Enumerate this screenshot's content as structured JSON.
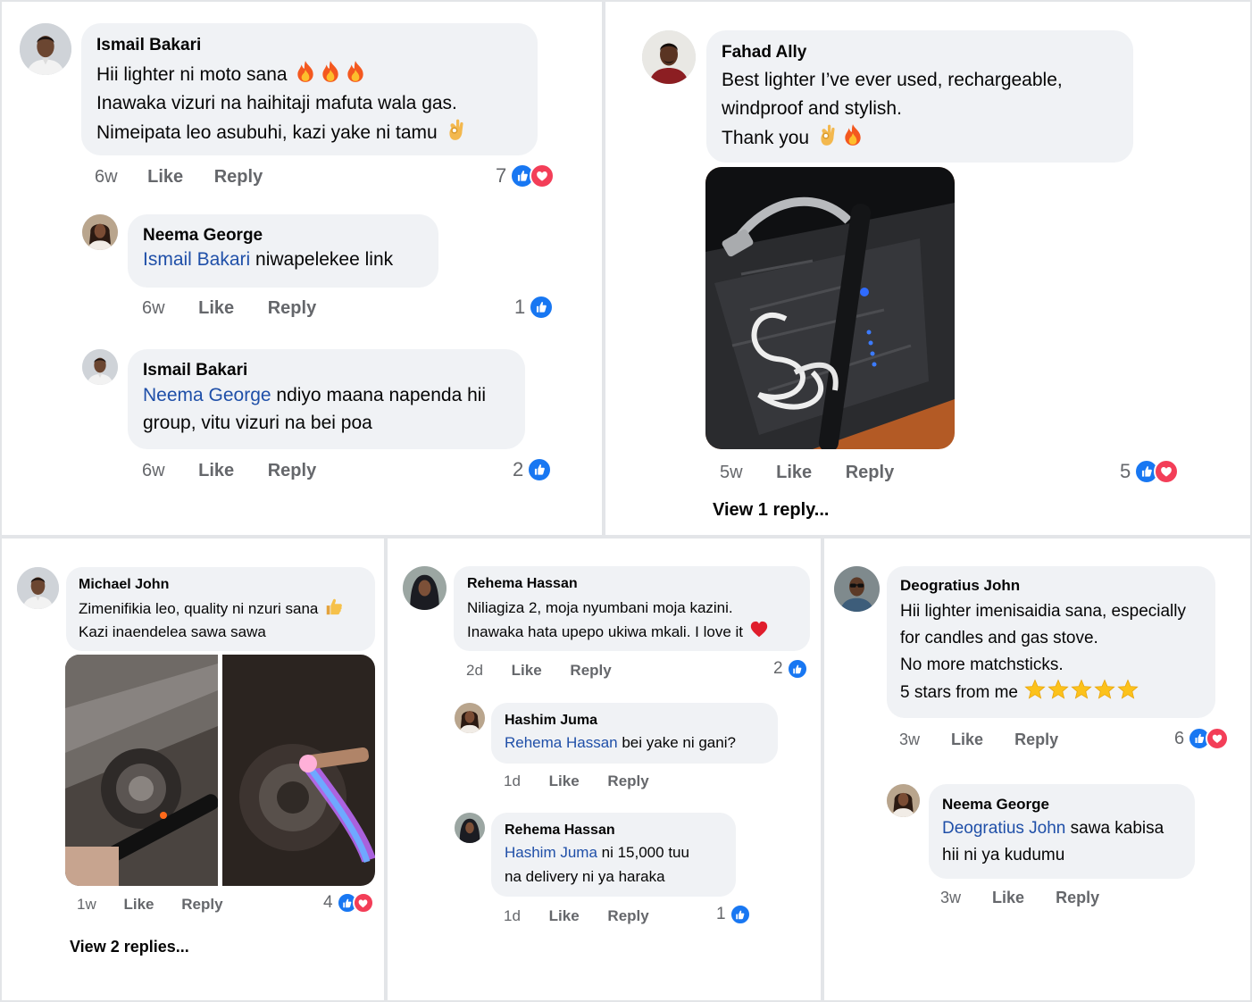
{
  "panel1": {
    "c1": {
      "author": "Ismail Bakari",
      "lines": [
        "Hii lighter ni moto sana",
        "Inawaka vizuri na haihitaji mafuta wala gas.",
        "Nimeipata leo asubuhi, kazi yake ni tamu"
      ],
      "time": "6w",
      "like": "Like",
      "reply": "Reply",
      "count": "7"
    },
    "c2": {
      "author": "Neema George",
      "mention": "Ismail Bakari",
      "text": " niwapelekee link",
      "time": "6w",
      "like": "Like",
      "reply": "Reply",
      "count": "1"
    },
    "c3": {
      "author": "Ismail Bakari",
      "mention": "Neema George",
      "text": " ndiyo maana napenda hii",
      "line2": "group, vitu vizuri na bei poa",
      "time": "6w",
      "like": "Like",
      "reply": "Reply",
      "count": "2"
    }
  },
  "panel2": {
    "c1": {
      "author": "Fahad Ally",
      "lines": [
        "Best lighter I’ve ever used, rechargeable,",
        "windproof and stylish.",
        "Thank you"
      ],
      "time": "5w",
      "like": "Like",
      "reply": "Reply",
      "count": "5"
    },
    "view_replies": "View 1 reply..."
  },
  "panel3": {
    "c1": {
      "author": "Michael John",
      "lines": [
        "Zimenifikia leo, quality ni nzuri sana",
        "Kazi inaendelea sawa sawa"
      ],
      "time": "1w",
      "like": "Like",
      "reply": "Reply",
      "count": "4"
    },
    "view_replies": "View 2 replies..."
  },
  "panel4": {
    "c1": {
      "author": "Rehema Hassan",
      "lines": [
        "Niliagiza 2, moja nyumbani moja kazini.",
        "Inawaka hata upepo ukiwa mkali. I love it"
      ],
      "time": "2d",
      "like": "Like",
      "reply": "Reply",
      "count": "2"
    },
    "c2": {
      "author": "Hashim Juma",
      "mention": "Rehema Hassan",
      "text": " bei yake ni gani?",
      "time": "1d",
      "like": "Like",
      "reply": "Reply"
    },
    "c3": {
      "author": "Rehema Hassan",
      "mention": "Hashim Juma",
      "text": " ni 15,000 tuu",
      "line2": "na delivery ni ya haraka",
      "time": "1d",
      "like": "Like",
      "reply": "Reply",
      "count": "1"
    }
  },
  "panel5": {
    "c1": {
      "author": "Deogratius John",
      "lines": [
        "Hii lighter imenisaidia sana, especially",
        "for candles and gas stove.",
        "No more matchsticks.",
        "5 stars from me"
      ],
      "time": "3w",
      "like": "Like",
      "reply": "Reply",
      "count": "6"
    },
    "c2": {
      "author": "Neema George",
      "mention": "Deogratius John",
      "text": " sawa kabisa",
      "line2": "hii ni ya kudumu",
      "time": "3w",
      "like": "Like",
      "reply": "Reply"
    }
  },
  "colors": {
    "bubble": "#f0f2f5",
    "mention": "#1f4fa8",
    "like": "#1877f2",
    "love": "#f33e58",
    "meta": "#65676b"
  },
  "icons": [
    "fire-emoji",
    "ok-hand-emoji",
    "thumbs-up-emoji",
    "red-heart-emoji",
    "star-emoji",
    "like-reaction-icon",
    "love-reaction-icon"
  ]
}
